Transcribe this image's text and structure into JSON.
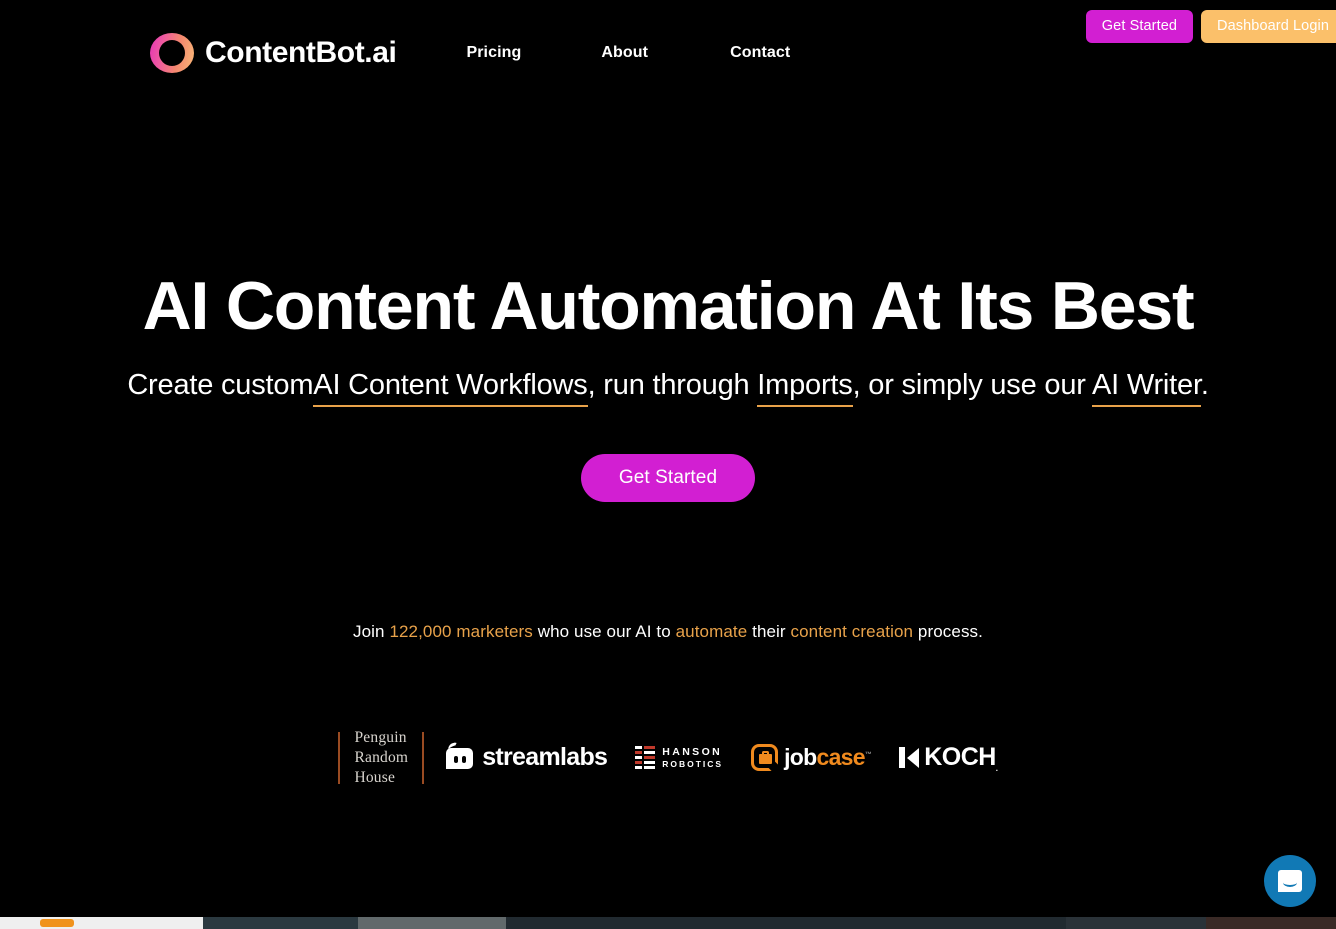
{
  "site": {
    "brand_name": "ContentBot.ai",
    "logo_icon": "gradient-ring-icon",
    "accent_magenta": "#d21fd2",
    "accent_orange": "#e8a24a",
    "background": "#000000"
  },
  "auth": {
    "get_started_label": "Get Started",
    "dashboard_login_label": "Dashboard Login"
  },
  "nav": {
    "items": [
      {
        "label": "Pricing"
      },
      {
        "label": "About"
      },
      {
        "label": "Contact"
      }
    ]
  },
  "hero": {
    "title": "AI Content Automation At Its Best",
    "sub_part1": "Create custom",
    "sub_link1": "AI Content Workflows",
    "sub_part2": ", run through ",
    "sub_link2": "Imports",
    "sub_part3": ", or simply use our ",
    "sub_link3": "AI Writer",
    "sub_part4": ".",
    "cta_label": "Get Started"
  },
  "social_proof": {
    "pre": "Join ",
    "count": "122,000 marketers",
    "mid1": " who use our AI to ",
    "verb": "automate",
    "mid2": " their ",
    "noun": "content creation",
    "post": " process."
  },
  "clients": {
    "penguin_line1": "Penguin",
    "penguin_line2": "Random",
    "penguin_line3": "House",
    "streamlabs": "streamlabs",
    "hanson_line1": "HANSON",
    "hanson_line2": "ROBOTICS",
    "jobcase_job": "job",
    "jobcase_case": "case",
    "jobcase_tm": "™",
    "koch": "KOCH",
    "koch_tm": "."
  },
  "chat": {
    "launcher_icon": "chat-bubble-icon"
  }
}
